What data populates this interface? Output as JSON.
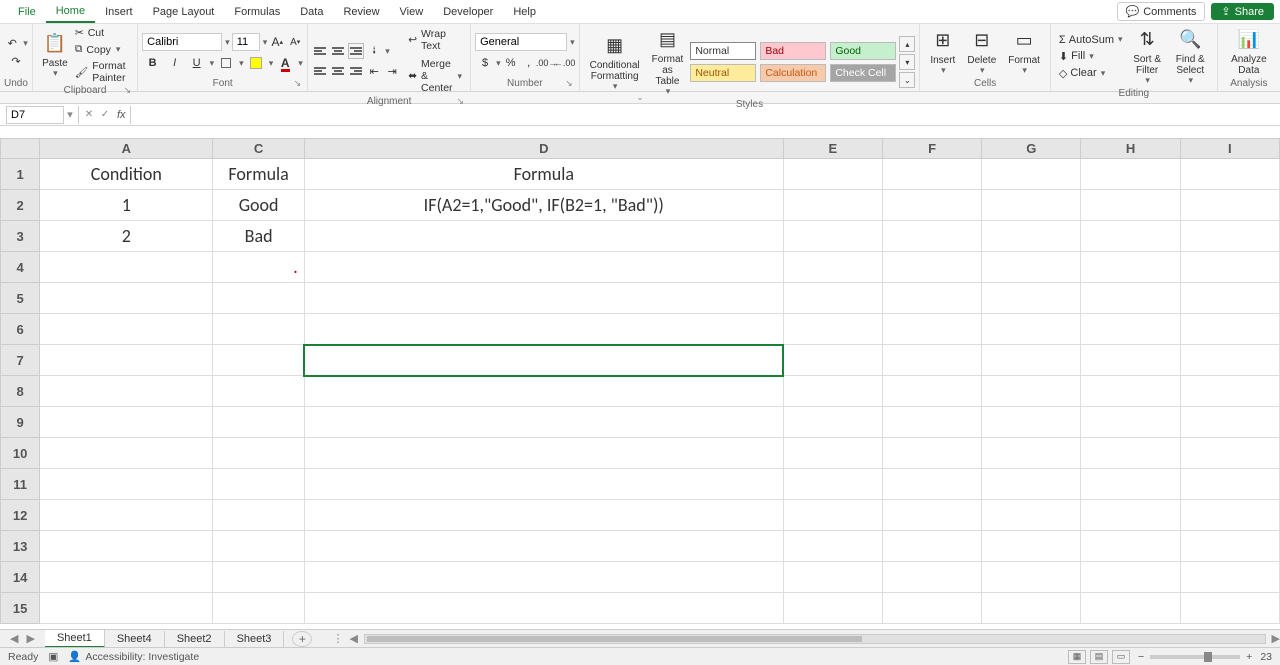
{
  "menu": {
    "tabs": [
      "File",
      "Home",
      "Insert",
      "Page Layout",
      "Formulas",
      "Data",
      "Review",
      "View",
      "Developer",
      "Help"
    ],
    "active": "Home",
    "comments": "Comments",
    "share": "Share"
  },
  "ribbon": {
    "undo_label": "Undo",
    "clipboard": {
      "paste": "Paste",
      "cut": "Cut",
      "copy": "Copy",
      "format_painter": "Format Painter",
      "label": "Clipboard"
    },
    "font": {
      "name": "Calibri",
      "size": "11",
      "label": "Font"
    },
    "alignment": {
      "wrap": "Wrap Text",
      "merge": "Merge & Center",
      "label": "Alignment"
    },
    "number": {
      "format": "General",
      "label": "Number"
    },
    "styles": {
      "cond_fmt": "Conditional Formatting",
      "fmt_table": "Format as Table",
      "normal": "Normal",
      "bad": "Bad",
      "good": "Good",
      "neutral": "Neutral",
      "calc": "Calculation",
      "check": "Check Cell",
      "label": "Styles"
    },
    "cells": {
      "insert": "Insert",
      "delete": "Delete",
      "format": "Format",
      "label": "Cells"
    },
    "editing": {
      "autosum": "AutoSum",
      "fill": "Fill",
      "clear": "Clear",
      "sort": "Sort & Filter",
      "find": "Find & Select",
      "label": "Editing"
    },
    "analysis": {
      "analyze": "Analyze Data",
      "label": "Analysis"
    }
  },
  "namebox": "D7",
  "formula_bar": "",
  "columns": [
    "A",
    "C",
    "D",
    "E",
    "F",
    "G",
    "H",
    "I"
  ],
  "rows": [
    "1",
    "2",
    "3",
    "4",
    "5",
    "6",
    "7",
    "8",
    "9",
    "10",
    "11",
    "12",
    "13",
    "14",
    "15"
  ],
  "cells": {
    "A1": "Condition",
    "C1": "Formula",
    "D1": "Formula",
    "A2": "1",
    "C2": "Good",
    "D2": "IF(A2=1,\"Good\", IF(B2=1, \"Bad\"))",
    "A3": "2",
    "C3": "Bad"
  },
  "selected_cell": "D7",
  "sheets": {
    "tabs": [
      "Sheet1",
      "Sheet4",
      "Sheet2",
      "Sheet3"
    ],
    "active": "Sheet1"
  },
  "status": {
    "ready": "Ready",
    "accessibility": "Accessibility: Investigate",
    "zoom": "23"
  }
}
